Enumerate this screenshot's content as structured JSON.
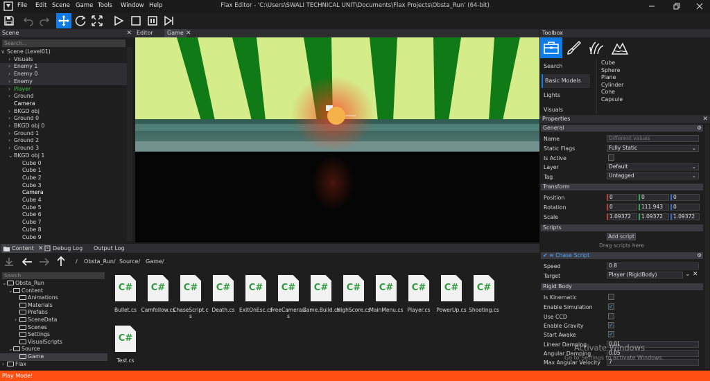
{
  "titlebar": {
    "menu": [
      "File",
      "Edit",
      "Scene",
      "Game",
      "Tools",
      "Window",
      "Help"
    ],
    "title": "Flax Editor - 'C:\\Users\\SWALI TECHNICAL UNIT\\Documents\\Flax Projects\\Obsta_Run' (64-bit)"
  },
  "toolbar": {
    "buttons": [
      "save-icon",
      "undo-icon",
      "redo-icon",
      "move-icon",
      "rotate-icon",
      "scale-icon",
      "play-icon",
      "stop-icon",
      "pause-icon"
    ],
    "active": "move-icon"
  },
  "scene": {
    "header": "Scene",
    "search_placeholder": "Search...",
    "root": "Scene (Level01)",
    "items": [
      {
        "label": "Visuals",
        "depth": 1,
        "caret": ">"
      },
      {
        "label": "Enemy 1",
        "depth": 1,
        "caret": ">"
      },
      {
        "label": "Enemy 0",
        "depth": 1,
        "caret": ">"
      },
      {
        "label": "Enemy",
        "depth": 1,
        "caret": ">"
      },
      {
        "label": "Player",
        "depth": 1,
        "caret": ">"
      },
      {
        "label": "Ground",
        "depth": 1,
        "caret": ">"
      },
      {
        "label": "Camera",
        "depth": 1,
        "caret": ""
      },
      {
        "label": "BKGD obj",
        "depth": 1,
        "caret": ">"
      },
      {
        "label": "Ground 0",
        "depth": 1,
        "caret": ">"
      },
      {
        "label": "BKGD obj 0",
        "depth": 1,
        "caret": ">"
      },
      {
        "label": "Ground 1",
        "depth": 1,
        "caret": ">"
      },
      {
        "label": "Ground 2",
        "depth": 1,
        "caret": ">"
      },
      {
        "label": "Ground 3",
        "depth": 1,
        "caret": ">"
      },
      {
        "label": "BKGD obj 1",
        "depth": 1,
        "caret": "v"
      },
      {
        "label": "Cube 0",
        "depth": 2,
        "caret": ""
      },
      {
        "label": "Cube 1",
        "depth": 2,
        "caret": ""
      },
      {
        "label": "Cube 2",
        "depth": 2,
        "caret": ""
      },
      {
        "label": "Cube 3",
        "depth": 2,
        "caret": ""
      },
      {
        "label": "Camera",
        "depth": 2,
        "caret": ""
      },
      {
        "label": "Cube 4",
        "depth": 2,
        "caret": ""
      },
      {
        "label": "Cube 5",
        "depth": 2,
        "caret": ""
      },
      {
        "label": "Cube 6",
        "depth": 2,
        "caret": ""
      },
      {
        "label": "Cube 7",
        "depth": 2,
        "caret": ""
      },
      {
        "label": "Cube 8",
        "depth": 2,
        "caret": ""
      },
      {
        "label": "Cube 9",
        "depth": 2,
        "caret": ""
      }
    ],
    "highlight_color": "#3bc13b"
  },
  "viewport": {
    "tabs": [
      "Editor",
      "Game"
    ],
    "active_tab": "Game"
  },
  "content": {
    "tabs": [
      "Content",
      "Debug Log",
      "Output Log"
    ],
    "breadcrumb": [
      "Obsta_Run/",
      "Source/",
      "Game/"
    ],
    "breadcrumb_sep": "/",
    "search_placeholder": "Search",
    "tree": [
      {
        "label": "Obsta_Run",
        "depth": 0,
        "caret": "v"
      },
      {
        "label": "Content",
        "depth": 1,
        "caret": "v"
      },
      {
        "label": "Animations",
        "depth": 2,
        "caret": ""
      },
      {
        "label": "Materials",
        "depth": 2,
        "caret": ""
      },
      {
        "label": "Prefabs",
        "depth": 2,
        "caret": ""
      },
      {
        "label": "SceneData",
        "depth": 2,
        "caret": ">"
      },
      {
        "label": "Scenes",
        "depth": 2,
        "caret": ""
      },
      {
        "label": "Settings",
        "depth": 2,
        "caret": ""
      },
      {
        "label": "VisualScripts",
        "depth": 2,
        "caret": ""
      },
      {
        "label": "Source",
        "depth": 1,
        "caret": "v"
      },
      {
        "label": "Game",
        "depth": 2,
        "caret": ""
      },
      {
        "label": "Flax",
        "depth": 0,
        "caret": ">"
      }
    ],
    "file_badge": "C#",
    "files": [
      "Bullet.cs",
      "Camfollow.cs",
      "ChaseScript.cs",
      "Death.cs",
      "ExitOnEsc.cs",
      "FreeCamera.cs",
      "Game.Build.cs",
      "HighScore.cs",
      "MainMenu.cs",
      "Player.cs",
      "PowerUp.cs",
      "Shooting.cs",
      "Test.cs"
    ]
  },
  "toolbox": {
    "header": "Toolbox",
    "tabs": [
      "briefcase-icon",
      "paint-brush-icon",
      "foliage-icon",
      "terrain-icon"
    ],
    "categories": [
      "Search",
      "Basic Models",
      "Lights",
      "Visuals"
    ],
    "active_category": "Basic Models",
    "items": [
      "Cube",
      "Sphere",
      "Plane",
      "Cylinder",
      "Cone",
      "Capsule"
    ]
  },
  "properties": {
    "header": "Properties",
    "general": {
      "title": "General",
      "name_label": "Name",
      "name_placeholder": "Different values",
      "static_flags_label": "Static Flags",
      "static_flags_value": "Fully Static",
      "is_active_label": "Is Active",
      "layer_label": "Layer",
      "layer_value": "Default",
      "tag_label": "Tag",
      "tag_value": "Untagged"
    },
    "transform": {
      "title": "Transform",
      "position_label": "Position",
      "position": [
        "0",
        "0",
        "0"
      ],
      "rotation_label": "Rotation",
      "rotation": [
        "0",
        "111.943",
        "0"
      ],
      "scale_label": "Scale",
      "scale": [
        "1.09372",
        "1.09372",
        "1.09372"
      ]
    },
    "scripts": {
      "title": "Scripts",
      "add_button": "Add script",
      "hint": "Drag scripts here"
    },
    "chase_script": {
      "title": "Chase Script",
      "speed_label": "Speed",
      "speed": "0.8",
      "target_label": "Target",
      "target": "Player (RigidBody)"
    },
    "rigidbody": {
      "title": "Rigid Body",
      "is_kinematic": "Is Kinematic",
      "enable_simulation": "Enable Simulation",
      "use_ccd": "Use CCD",
      "enable_gravity": "Enable Gravity",
      "start_awake": "Start Awake",
      "linear_damping_label": "Linear Damping",
      "linear_damping": "0.01",
      "angular_damping_label": "Angular Damping",
      "angular_damping": "0.05",
      "max_angular_velocity_label": "Max Angular Velocity",
      "max_angular_velocity": "7"
    }
  },
  "statusbar": {
    "text": "Play Mode!",
    "color": "#ff4f12"
  },
  "watermark": {
    "line1": "Activate Windows",
    "line2": "Go to Settings to activate Windows."
  }
}
